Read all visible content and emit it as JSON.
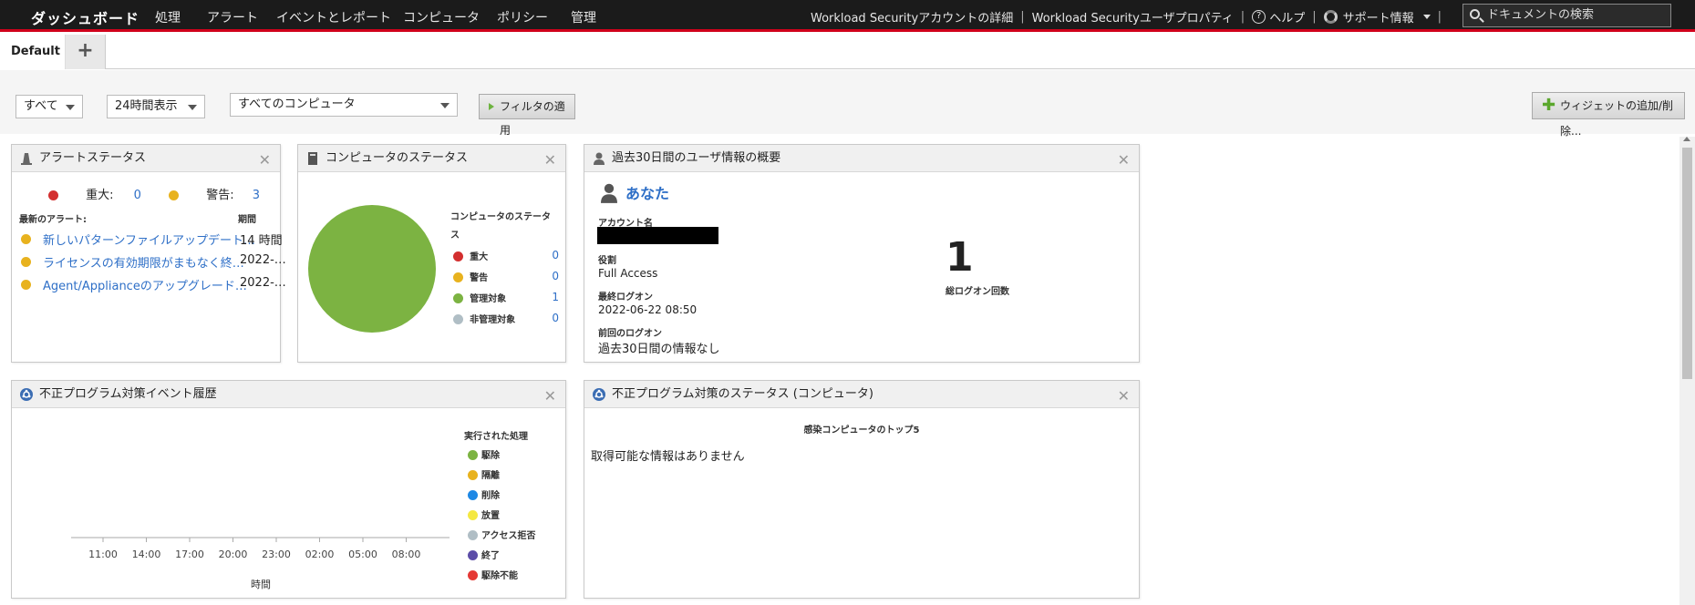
{
  "topnav": {
    "brand": "ダッシュボード",
    "items": [
      "処理",
      "アラート",
      "イベントとレポート",
      "コンピュータ",
      "ポリシー",
      "管理"
    ],
    "account_details": "Workload Securityアカウントの詳細",
    "user_properties": "Workload Securityユーザプロパティ",
    "help": "ヘルプ",
    "support": "サポート情報",
    "search_placeholder": "ドキュメントの検索"
  },
  "tabs": {
    "default_label": "Default",
    "add_label": "+"
  },
  "filters": {
    "scope": "すべて",
    "time": "24時間表示",
    "computers": "すべてのコンピュータ",
    "apply": "フィルタの適用",
    "widgets": "ウィジェットの追加/削除..."
  },
  "alert_status": {
    "title": "アラートステータス",
    "critical_label": "重大:",
    "critical_count": "0",
    "warning_label": "警告:",
    "warning_count": "3",
    "col_latest": "最新のアラート:",
    "col_period": "期間",
    "rows": [
      {
        "text": "新しいパターンファイルアップデート…",
        "period": "14 時間"
      },
      {
        "text": "ライセンスの有効期限がまもなく終…",
        "period": "2022-…"
      },
      {
        "text": "Agent/Applianceのアップグレード…",
        "period": "2022-…"
      }
    ]
  },
  "computer_status": {
    "title": "コンピュータのステータス",
    "legend_title": "コンピュータのステータス",
    "legend": [
      {
        "label": "重大",
        "count": "0",
        "color": "#d32f2f"
      },
      {
        "label": "警告",
        "count": "0",
        "color": "#e8b21e"
      },
      {
        "label": "管理対象",
        "count": "1",
        "color": "#7cb342"
      },
      {
        "label": "非管理対象",
        "count": "0",
        "color": "#b0bec5"
      }
    ],
    "pie_color": "#7cb342"
  },
  "user_summary": {
    "title": "過去30日間のユーザ情報の概要",
    "user": "あなた",
    "account_label": "アカウント名",
    "role_label": "役割",
    "role": "Full Access",
    "last_logon_label": "最終ログオン",
    "last_logon": "2022-06-22 08:50",
    "prev_logon_label": "前回のログオン",
    "prev_logon": "過去30日間の情報なし",
    "logon_count": "1",
    "logon_count_label": "総ログオン回数"
  },
  "malware_events": {
    "title": "不正プログラム対策イベント履歴",
    "legend_title": "実行された処理",
    "legend": [
      {
        "label": "駆除",
        "color": "#7cb342"
      },
      {
        "label": "隔離",
        "color": "#e8b21e"
      },
      {
        "label": "削除",
        "color": "#1e88e5"
      },
      {
        "label": "放置",
        "color": "#f4e842"
      },
      {
        "label": "アクセス拒否",
        "color": "#b0bec5"
      },
      {
        "label": "終了",
        "color": "#5c4da8"
      },
      {
        "label": "駆除不能",
        "color": "#e53935"
      }
    ],
    "x_ticks": [
      "11:00",
      "14:00",
      "17:00",
      "20:00",
      "23:00",
      "02:00",
      "05:00",
      "08:00"
    ],
    "x_label": "時間"
  },
  "malware_status": {
    "title": "不正プログラム対策のステータス (コンピュータ)",
    "subtitle": "感染コンピュータのトップ5",
    "empty": "取得可能な情報はありません"
  }
}
